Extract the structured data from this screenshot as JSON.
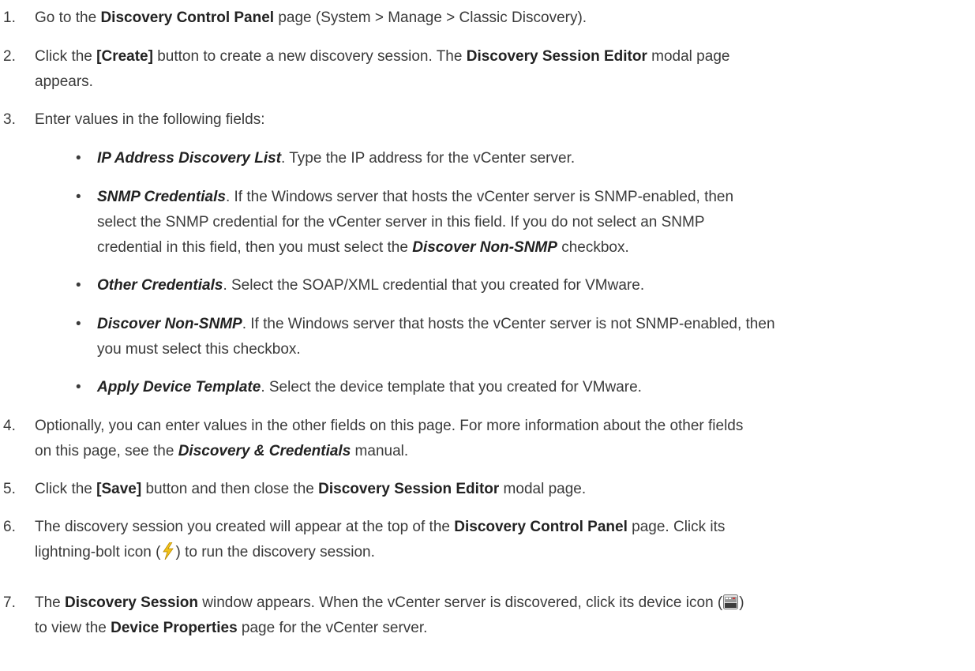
{
  "steps": [
    {
      "num": "1.",
      "t1": "Go to the ",
      "b1": "Discovery Control Panel",
      "t2": " page (System > Manage > Classic Discovery)."
    },
    {
      "num": "2.",
      "t1": "Click the ",
      "b1": "[Create]",
      "t2": " button to create a new discovery session. The ",
      "b2": "Discovery Session Editor",
      "t3": " modal page",
      "t4": "appears."
    },
    {
      "num": "3.",
      "t1": "Enter values in the following fields:"
    },
    {
      "num": "4.",
      "t1": "Optionally, you can enter values in the other fields on this page. For more information about the other fields",
      "t2": "on this page, see the ",
      "b1": "Discovery & Credentials",
      "t3": " manual."
    },
    {
      "num": "5.",
      "t1": "Click the ",
      "b1": "[Save]",
      "t2": " button and then close the ",
      "b2": "Discovery Session Editor",
      "t3": " modal page."
    },
    {
      "num": "6.",
      "t1": "The discovery session you created will appear at the top of the ",
      "b1": "Discovery Control Panel",
      "t2": " page. Click its",
      "t3": "lightning-bolt icon (",
      "t4": ") to run the discovery session."
    },
    {
      "num": "7.",
      "t1": "The ",
      "b1": "Discovery Session",
      "t2": " window appears. When the vCenter server is discovered, click its device icon (",
      "t3": ")",
      "t4": "to view the ",
      "b2": "Device Properties",
      "t5": " page for the vCenter server."
    }
  ],
  "fields": [
    {
      "bullet": "•",
      "name": "IP Address Discovery List",
      "t1": ". Type the IP address for the vCenter server."
    },
    {
      "bullet": "•",
      "name": "SNMP Credentials",
      "t1": ". If the Windows server that hosts the vCenter server is SNMP-enabled, then",
      "t2": "select the SNMP credential for the vCenter server in this field. If you do not select an SNMP",
      "t3": "credential in this field, then you must select the ",
      "name2": "Discover Non-SNMP",
      "t4": " checkbox."
    },
    {
      "bullet": "•",
      "name": "Other Credentials",
      "t1": ". Select the SOAP/XML credential that you created for VMware."
    },
    {
      "bullet": "•",
      "name": "Discover Non-SNMP",
      "t1": ". If the Windows server that hosts the vCenter server is not SNMP-enabled, then",
      "t2": "you must select this checkbox."
    },
    {
      "bullet": "•",
      "name": "Apply Device Template",
      "t1": ". Select the device template that you created for VMware."
    }
  ],
  "icons": {
    "bolt": "lightning-bolt-icon",
    "device": "device-icon",
    "bolt_color": "#f2c21a",
    "device_color": "#6e6e6e"
  }
}
